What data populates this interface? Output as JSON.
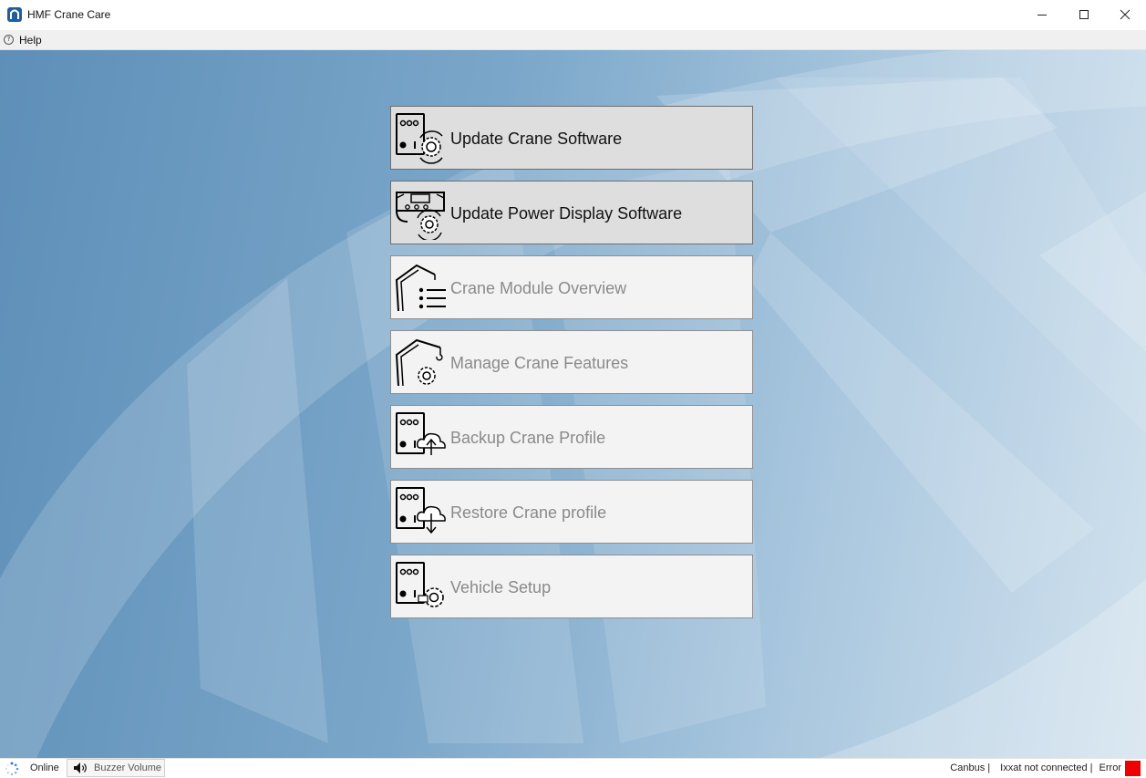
{
  "window": {
    "title": "HMF Crane Care",
    "controls": [
      "minimize",
      "maximize",
      "close"
    ]
  },
  "menu": {
    "help_label": "Help"
  },
  "tiles": [
    {
      "label": "Update Crane Software",
      "icon": "controller-gear-icon",
      "enabled": true
    },
    {
      "label": "Update Power Display Software",
      "icon": "power-display-gear-icon",
      "enabled": true
    },
    {
      "label": "Crane Module Overview",
      "icon": "crane-list-icon",
      "enabled": false
    },
    {
      "label": "Manage Crane Features",
      "icon": "crane-gear-icon",
      "enabled": false
    },
    {
      "label": "Backup Crane Profile",
      "icon": "controller-cloud-upload-icon",
      "enabled": false
    },
    {
      "label": "Restore Crane profile",
      "icon": "controller-cloud-download-icon",
      "enabled": false
    },
    {
      "label": "Vehicle Setup",
      "icon": "controller-truck-gear-icon",
      "enabled": false
    }
  ],
  "status": {
    "connection": "Online",
    "buzzer_label": "Buzzer Volume",
    "canbus_label": "Canbus |",
    "adapter_status": "Ixxat not connected |",
    "state": "Error",
    "state_color": "#ee0000"
  },
  "colors": {
    "background_blue": "#7aa6c9",
    "tile_active": "#dedede",
    "tile_disabled": "#f3f3f3"
  }
}
